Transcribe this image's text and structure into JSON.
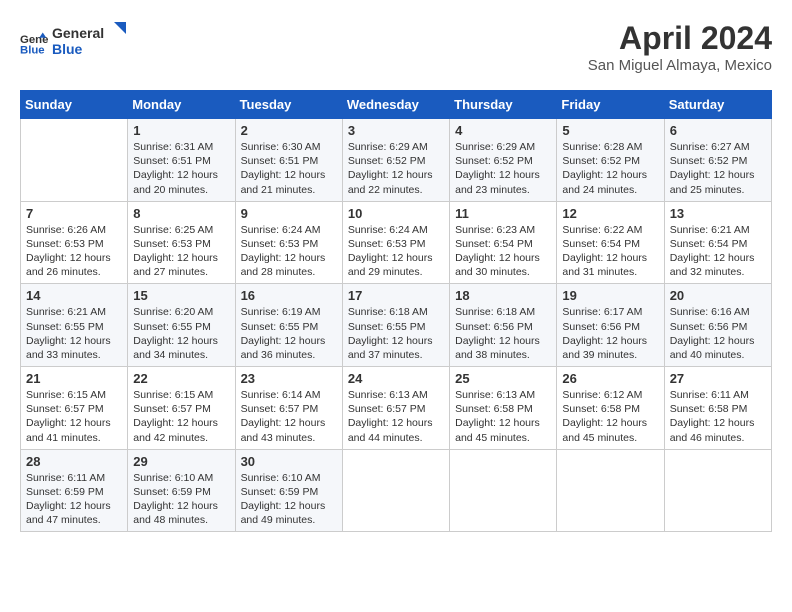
{
  "header": {
    "logo_line1": "General",
    "logo_line2": "Blue",
    "month": "April 2024",
    "location": "San Miguel Almaya, Mexico"
  },
  "weekdays": [
    "Sunday",
    "Monday",
    "Tuesday",
    "Wednesday",
    "Thursday",
    "Friday",
    "Saturday"
  ],
  "weeks": [
    [
      {
        "day": "",
        "info": ""
      },
      {
        "day": "1",
        "info": "Sunrise: 6:31 AM\nSunset: 6:51 PM\nDaylight: 12 hours\nand 20 minutes."
      },
      {
        "day": "2",
        "info": "Sunrise: 6:30 AM\nSunset: 6:51 PM\nDaylight: 12 hours\nand 21 minutes."
      },
      {
        "day": "3",
        "info": "Sunrise: 6:29 AM\nSunset: 6:52 PM\nDaylight: 12 hours\nand 22 minutes."
      },
      {
        "day": "4",
        "info": "Sunrise: 6:29 AM\nSunset: 6:52 PM\nDaylight: 12 hours\nand 23 minutes."
      },
      {
        "day": "5",
        "info": "Sunrise: 6:28 AM\nSunset: 6:52 PM\nDaylight: 12 hours\nand 24 minutes."
      },
      {
        "day": "6",
        "info": "Sunrise: 6:27 AM\nSunset: 6:52 PM\nDaylight: 12 hours\nand 25 minutes."
      }
    ],
    [
      {
        "day": "7",
        "info": "Sunrise: 6:26 AM\nSunset: 6:53 PM\nDaylight: 12 hours\nand 26 minutes."
      },
      {
        "day": "8",
        "info": "Sunrise: 6:25 AM\nSunset: 6:53 PM\nDaylight: 12 hours\nand 27 minutes."
      },
      {
        "day": "9",
        "info": "Sunrise: 6:24 AM\nSunset: 6:53 PM\nDaylight: 12 hours\nand 28 minutes."
      },
      {
        "day": "10",
        "info": "Sunrise: 6:24 AM\nSunset: 6:53 PM\nDaylight: 12 hours\nand 29 minutes."
      },
      {
        "day": "11",
        "info": "Sunrise: 6:23 AM\nSunset: 6:54 PM\nDaylight: 12 hours\nand 30 minutes."
      },
      {
        "day": "12",
        "info": "Sunrise: 6:22 AM\nSunset: 6:54 PM\nDaylight: 12 hours\nand 31 minutes."
      },
      {
        "day": "13",
        "info": "Sunrise: 6:21 AM\nSunset: 6:54 PM\nDaylight: 12 hours\nand 32 minutes."
      }
    ],
    [
      {
        "day": "14",
        "info": "Sunrise: 6:21 AM\nSunset: 6:55 PM\nDaylight: 12 hours\nand 33 minutes."
      },
      {
        "day": "15",
        "info": "Sunrise: 6:20 AM\nSunset: 6:55 PM\nDaylight: 12 hours\nand 34 minutes."
      },
      {
        "day": "16",
        "info": "Sunrise: 6:19 AM\nSunset: 6:55 PM\nDaylight: 12 hours\nand 36 minutes."
      },
      {
        "day": "17",
        "info": "Sunrise: 6:18 AM\nSunset: 6:55 PM\nDaylight: 12 hours\nand 37 minutes."
      },
      {
        "day": "18",
        "info": "Sunrise: 6:18 AM\nSunset: 6:56 PM\nDaylight: 12 hours\nand 38 minutes."
      },
      {
        "day": "19",
        "info": "Sunrise: 6:17 AM\nSunset: 6:56 PM\nDaylight: 12 hours\nand 39 minutes."
      },
      {
        "day": "20",
        "info": "Sunrise: 6:16 AM\nSunset: 6:56 PM\nDaylight: 12 hours\nand 40 minutes."
      }
    ],
    [
      {
        "day": "21",
        "info": "Sunrise: 6:15 AM\nSunset: 6:57 PM\nDaylight: 12 hours\nand 41 minutes."
      },
      {
        "day": "22",
        "info": "Sunrise: 6:15 AM\nSunset: 6:57 PM\nDaylight: 12 hours\nand 42 minutes."
      },
      {
        "day": "23",
        "info": "Sunrise: 6:14 AM\nSunset: 6:57 PM\nDaylight: 12 hours\nand 43 minutes."
      },
      {
        "day": "24",
        "info": "Sunrise: 6:13 AM\nSunset: 6:57 PM\nDaylight: 12 hours\nand 44 minutes."
      },
      {
        "day": "25",
        "info": "Sunrise: 6:13 AM\nSunset: 6:58 PM\nDaylight: 12 hours\nand 45 minutes."
      },
      {
        "day": "26",
        "info": "Sunrise: 6:12 AM\nSunset: 6:58 PM\nDaylight: 12 hours\nand 45 minutes."
      },
      {
        "day": "27",
        "info": "Sunrise: 6:11 AM\nSunset: 6:58 PM\nDaylight: 12 hours\nand 46 minutes."
      }
    ],
    [
      {
        "day": "28",
        "info": "Sunrise: 6:11 AM\nSunset: 6:59 PM\nDaylight: 12 hours\nand 47 minutes."
      },
      {
        "day": "29",
        "info": "Sunrise: 6:10 AM\nSunset: 6:59 PM\nDaylight: 12 hours\nand 48 minutes."
      },
      {
        "day": "30",
        "info": "Sunrise: 6:10 AM\nSunset: 6:59 PM\nDaylight: 12 hours\nand 49 minutes."
      },
      {
        "day": "",
        "info": ""
      },
      {
        "day": "",
        "info": ""
      },
      {
        "day": "",
        "info": ""
      },
      {
        "day": "",
        "info": ""
      }
    ]
  ]
}
